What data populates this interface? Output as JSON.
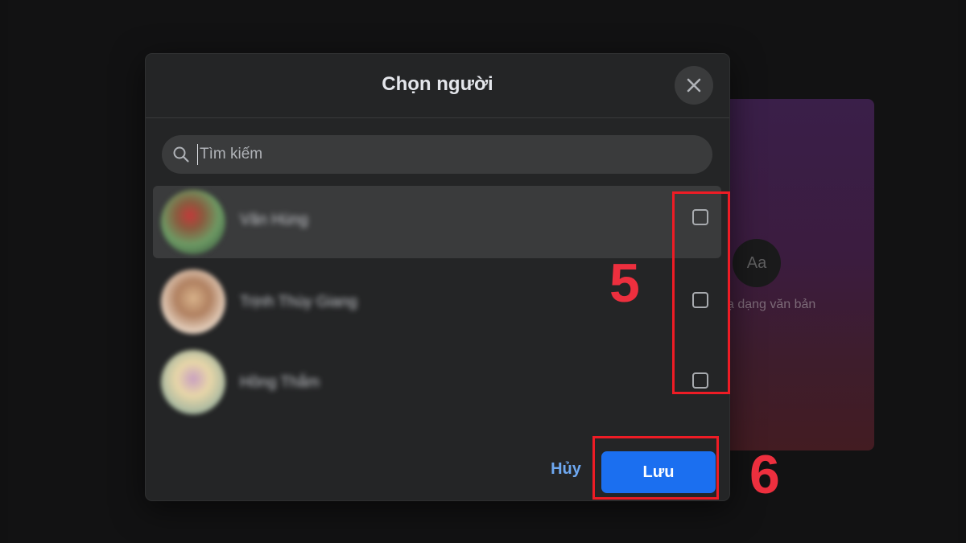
{
  "modal": {
    "title": "Chọn người",
    "search_placeholder": "Tìm kiếm",
    "contacts": [
      {
        "name": "Văn Hùng",
        "checked": false,
        "highlighted": true
      },
      {
        "name": "Trịnh Thùy Giang",
        "checked": false,
        "highlighted": false
      },
      {
        "name": "Hồng Thắm",
        "checked": false,
        "highlighted": false
      }
    ],
    "cancel_label": "Hủy",
    "save_label": "Lưu"
  },
  "background": {
    "aa_label": "Aa",
    "story_label": "ạ dạng văn bản"
  },
  "annotations": {
    "step5": "5",
    "step6": "6"
  },
  "colors": {
    "highlight": "#ee1c25",
    "step_number": "#ed2f3e",
    "primary": "#1b6ff0",
    "modal_bg": "#242526"
  },
  "icons": {
    "close": "close-icon",
    "search": "search-icon"
  }
}
